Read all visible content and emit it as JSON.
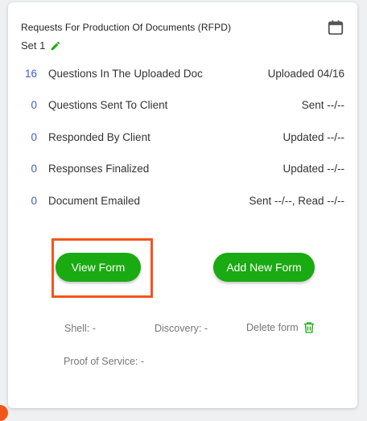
{
  "card": {
    "title": "Requests For Production Of Documents (RFPD)",
    "set_label": "Set 1",
    "icons": {
      "calendar": "calendar-icon",
      "edit": "pencil-icon",
      "delete": "trash-icon"
    },
    "stats": [
      {
        "count": "16",
        "label": "Questions In The Uploaded Doc",
        "status": "Uploaded 04/16"
      },
      {
        "count": "0",
        "label": "Questions Sent To Client",
        "status": "Sent --/--"
      },
      {
        "count": "0",
        "label": "Responded By Client",
        "status": "Updated --/--"
      },
      {
        "count": "0",
        "label": "Responses Finalized",
        "status": "Updated --/--"
      },
      {
        "count": "0",
        "label": "Document Emailed",
        "status": "Sent --/--, Read --/--"
      }
    ],
    "buttons": {
      "view_form": "View Form",
      "add_new_form": "Add New Form"
    },
    "meta": {
      "shell": "Shell: -",
      "discovery": "Discovery: -",
      "delete_form": "Delete form",
      "proof_of_service": "Proof of Service: -"
    }
  },
  "colors": {
    "accent_green": "#1aaa12",
    "count_blue": "#3d5bd6",
    "highlight_orange": "#f3561a"
  }
}
